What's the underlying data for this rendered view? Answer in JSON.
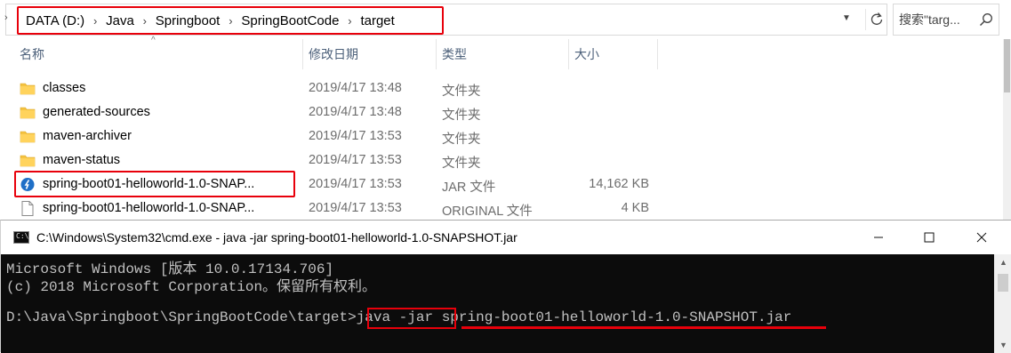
{
  "address_bar": {
    "crumbs": [
      "DATA (D:)",
      "Java",
      "Springboot",
      "SpringBootCode",
      "target"
    ]
  },
  "search": {
    "placeholder": "搜索\"targ..."
  },
  "columns": {
    "name": "名称",
    "date": "修改日期",
    "type": "类型",
    "size": "大小"
  },
  "files": [
    {
      "name": "classes",
      "date": "2019/4/17 13:48",
      "type": "文件夹",
      "size": "",
      "icon": "folder-icon"
    },
    {
      "name": "generated-sources",
      "date": "2019/4/17 13:48",
      "type": "文件夹",
      "size": "",
      "icon": "folder-icon"
    },
    {
      "name": "maven-archiver",
      "date": "2019/4/17 13:53",
      "type": "文件夹",
      "size": "",
      "icon": "folder-icon"
    },
    {
      "name": "maven-status",
      "date": "2019/4/17 13:53",
      "type": "文件夹",
      "size": "",
      "icon": "folder-icon"
    },
    {
      "name": "spring-boot01-helloworld-1.0-SNAP...",
      "date": "2019/4/17 13:53",
      "type": "JAR 文件",
      "size": "14,162 KB",
      "icon": "jar-icon"
    },
    {
      "name": "spring-boot01-helloworld-1.0-SNAP...",
      "date": "2019/4/17 13:53",
      "type": "ORIGINAL 文件",
      "size": "4 KB",
      "icon": "file-icon"
    }
  ],
  "cmd": {
    "title": "C:\\Windows\\System32\\cmd.exe - java  -jar spring-boot01-helloworld-1.0-SNAPSHOT.jar",
    "lines": [
      "Microsoft Windows [版本 10.0.17134.706]",
      "(c) 2018 Microsoft Corporation。保留所有权利。",
      ""
    ],
    "prompt": "D:\\Java\\Springboot\\SpringBootCode\\target>",
    "command": "java -jar",
    "argument": "spring-boot01-helloworld-1.0-SNAPSHOT.jar"
  },
  "colors": {
    "highlight": "#e8000b",
    "console_bg": "#0c0c0c",
    "console_text": "#c0c0c0",
    "folder": "#f5c342"
  }
}
